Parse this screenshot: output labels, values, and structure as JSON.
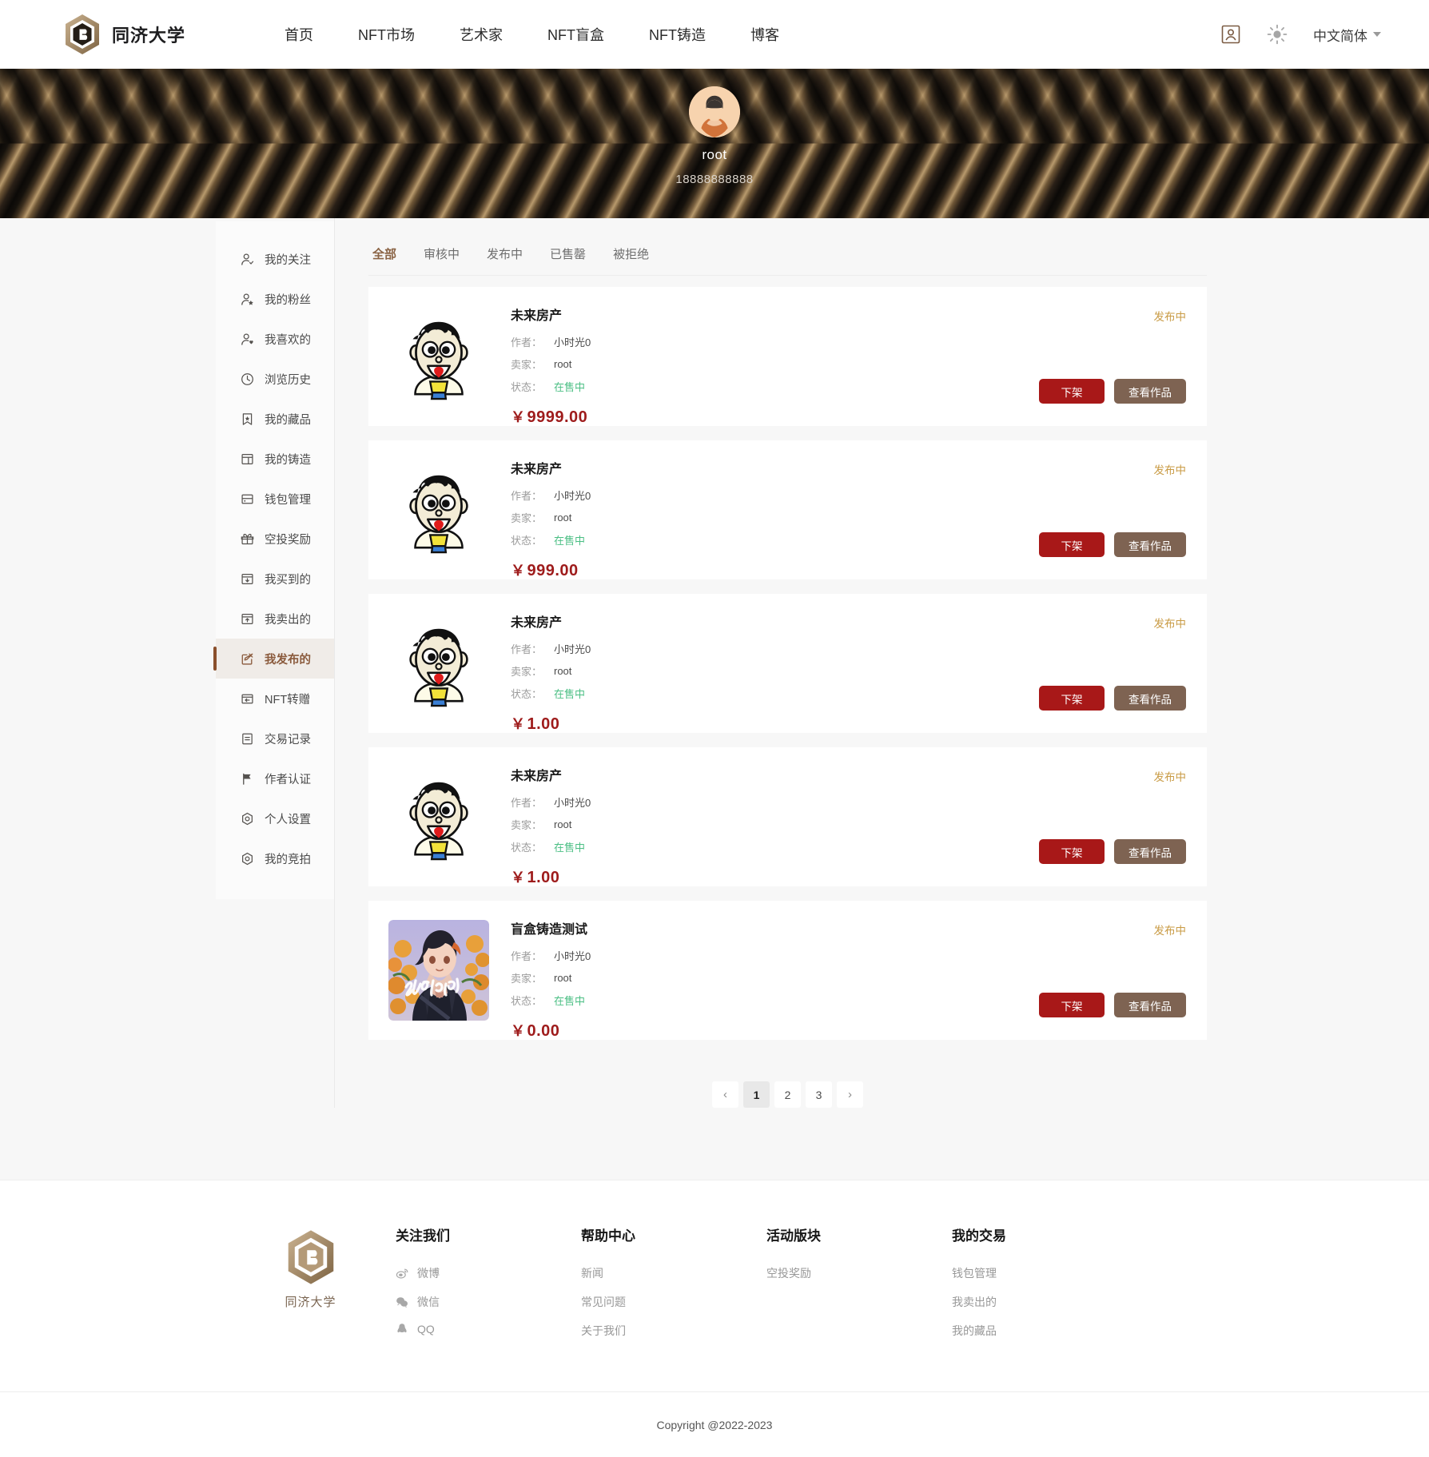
{
  "header": {
    "brand_name": "同济大学",
    "brand_logo_icon": "hexagon-logo-icon",
    "nav": [
      {
        "label": "首页"
      },
      {
        "label": "NFT市场"
      },
      {
        "label": "艺术家"
      },
      {
        "label": "NFT盲盒"
      },
      {
        "label": "NFT铸造"
      },
      {
        "label": "博客"
      }
    ],
    "account_icon": "user-card-icon",
    "theme_icon": "sun-icon",
    "language": "中文简体",
    "language_caret_icon": "chevron-down-icon"
  },
  "profile": {
    "avatar_icon": "user-avatar-icon",
    "name": "root",
    "phone": "18888888888"
  },
  "sidebar": {
    "items": [
      {
        "label": "我的关注",
        "icon": "user-check-icon",
        "active": false
      },
      {
        "label": "我的粉丝",
        "icon": "user-star-icon",
        "active": false
      },
      {
        "label": "我喜欢的",
        "icon": "user-heart-icon",
        "active": false
      },
      {
        "label": "浏览历史",
        "icon": "clock-icon",
        "active": false
      },
      {
        "label": "我的藏品",
        "icon": "bookmark-star-icon",
        "active": false
      },
      {
        "label": "我的铸造",
        "icon": "layout-icon",
        "active": false
      },
      {
        "label": "钱包管理",
        "icon": "wallet-icon",
        "active": false
      },
      {
        "label": "空投奖励",
        "icon": "gift-icon",
        "active": false
      },
      {
        "label": "我买到的",
        "icon": "box-download-icon",
        "active": false
      },
      {
        "label": "我卖出的",
        "icon": "box-upload-icon",
        "active": false
      },
      {
        "label": "我发布的",
        "icon": "edit-square-icon",
        "active": true
      },
      {
        "label": "NFT转赠",
        "icon": "transfer-icon",
        "active": false
      },
      {
        "label": "交易记录",
        "icon": "list-icon",
        "active": false
      },
      {
        "label": "作者认证",
        "icon": "flag-icon",
        "active": false
      },
      {
        "label": "个人设置",
        "icon": "hexagon-gear-icon",
        "active": false
      },
      {
        "label": "我的竞拍",
        "icon": "hexagon-gear-icon",
        "active": false
      }
    ]
  },
  "tabs": [
    {
      "label": "全部",
      "active": true
    },
    {
      "label": "审核中",
      "active": false
    },
    {
      "label": "发布中",
      "active": false
    },
    {
      "label": "已售罄",
      "active": false
    },
    {
      "label": "被拒绝",
      "active": false
    }
  ],
  "labels": {
    "author": "作者：",
    "seller": "卖家：",
    "state": "状态：",
    "btn_delist": "下架",
    "btn_view": "查看作品"
  },
  "cards": [
    {
      "thumb": "cartoon-boy",
      "title": "未来房产",
      "author": "小时光0",
      "seller": "root",
      "state": "在售中",
      "price": "9999.00",
      "currency": "￥",
      "status": "发布中"
    },
    {
      "thumb": "cartoon-boy",
      "title": "未来房产",
      "author": "小时光0",
      "seller": "root",
      "state": "在售中",
      "price": "999.00",
      "currency": "￥",
      "status": "发布中"
    },
    {
      "thumb": "cartoon-boy",
      "title": "未来房产",
      "author": "小时光0",
      "seller": "root",
      "state": "在售中",
      "price": "1.00",
      "currency": "￥",
      "status": "发布中"
    },
    {
      "thumb": "cartoon-boy",
      "title": "未来房产",
      "author": "小时光0",
      "seller": "root",
      "state": "在售中",
      "price": "1.00",
      "currency": "￥",
      "status": "发布中"
    },
    {
      "thumb": "anime-sample",
      "title": "盲盒铸造测试",
      "author": "小时光0",
      "seller": "root",
      "state": "在售中",
      "price": "0.00",
      "currency": "￥",
      "status": "发布中"
    }
  ],
  "pagination": {
    "prev_icon": "chevron-left-icon",
    "next_icon": "chevron-right-icon",
    "pages": [
      {
        "label": "1",
        "active": true
      },
      {
        "label": "2",
        "active": false
      },
      {
        "label": "3",
        "active": false
      }
    ]
  },
  "footer": {
    "brand_name": "同济大学",
    "brand_logo_icon": "hexagon-logo-icon",
    "columns": [
      {
        "title": "关注我们",
        "links": [
          {
            "label": "微博",
            "icon": "weibo-icon"
          },
          {
            "label": "微信",
            "icon": "wechat-icon"
          },
          {
            "label": "QQ",
            "icon": "qq-icon"
          }
        ]
      },
      {
        "title": "帮助中心",
        "links": [
          {
            "label": "新闻",
            "icon": ""
          },
          {
            "label": "常见问题",
            "icon": ""
          },
          {
            "label": "关于我们",
            "icon": ""
          }
        ]
      },
      {
        "title": "活动版块",
        "links": [
          {
            "label": "空投奖励",
            "icon": ""
          }
        ]
      },
      {
        "title": "我的交易",
        "links": [
          {
            "label": "钱包管理",
            "icon": ""
          },
          {
            "label": "我卖出的",
            "icon": ""
          },
          {
            "label": "我的藏品",
            "icon": ""
          }
        ]
      }
    ],
    "copyright": "Copyright @2022-2023"
  },
  "colors": {
    "accent_brown": "#8a5a3c",
    "danger_red": "#a81818",
    "btn_brown": "#7e6352",
    "status_gold": "#c99b45",
    "state_green": "#4bbf84",
    "price_red": "#9e1b1b"
  }
}
